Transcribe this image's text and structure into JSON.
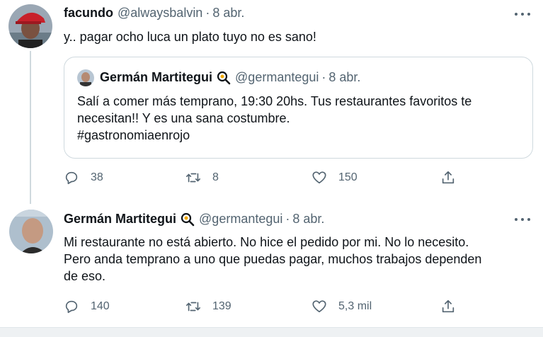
{
  "tweet1": {
    "name": "facundo",
    "handle": "@alwaysbalvin",
    "date": "8 abr.",
    "text": "y.. pagar ocho luca un plato tuyo no es sano!",
    "quote": {
      "name": "Germán Martitegui",
      "handle": "@germantegui",
      "date": "8 abr.",
      "lines": [
        "Salí a comer más temprano, 19:30 20hs. Tus restaurantes favoritos te",
        "necesitan!! Y es una sana costumbre.",
        "#gastronomiaenrojo"
      ]
    },
    "actions": {
      "replies": "38",
      "retweets": "8",
      "likes": "150"
    }
  },
  "tweet2": {
    "name": "Germán Martitegui",
    "handle": "@germantegui",
    "date": "8 abr.",
    "lines": [
      "Mi restaurante no está abierto. No hice el pedido por mi. No lo necesito.",
      "Pero anda temprano a uno que puedas pagar, muchos trabajos dependen",
      "de eso."
    ],
    "actions": {
      "replies": "140",
      "retweets": "139",
      "likes": "5,3 mil"
    }
  },
  "separator": "·",
  "icons": {
    "reply": "reply-icon",
    "retweet": "retweet-icon",
    "like": "heart-icon",
    "share": "share-icon",
    "more": "more-icon",
    "badge": "magnifier-badge-icon"
  },
  "colors": {
    "text": "#0f1419",
    "secondary": "#536471",
    "border": "#cfd9de"
  }
}
